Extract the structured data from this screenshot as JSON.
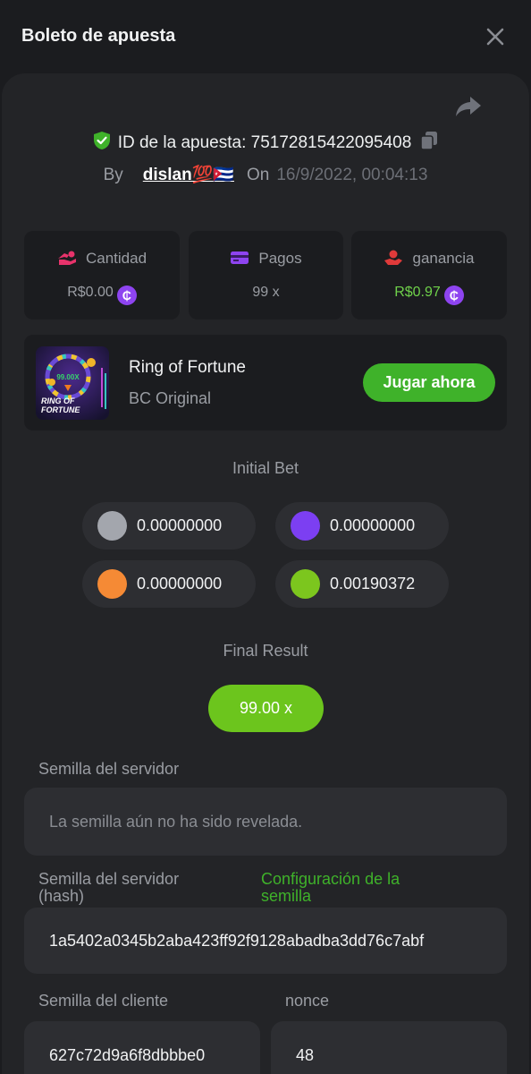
{
  "header": {
    "title": "Boleto de apuesta"
  },
  "bet": {
    "id_label": "ID de la apuesta:",
    "id_value": "75172815422095408",
    "by_label": "By",
    "user": "dislan💯🇨🇺",
    "on_label": "On",
    "date": "16/9/2022, 00:04:13"
  },
  "stats": [
    {
      "title": "Cantidad",
      "value": "R$0.00",
      "icon": "amount-icon",
      "color": "#e8336b"
    },
    {
      "title": "Pagos",
      "value": "99 x",
      "icon": "card-icon",
      "color": "#8e44f0"
    },
    {
      "title": "ganancia",
      "value": "R$0.97",
      "icon": "profit-icon",
      "color": "#e03a3a"
    }
  ],
  "coin_symbol": "₵",
  "game": {
    "name": "Ring of Fortune",
    "provider": "BC Original",
    "play_label": "Jugar ahora",
    "thumb_multiplier": "99.00X",
    "thumb_title_line1": "RING OF",
    "thumb_title_line2": "FORTUNE"
  },
  "initial_bet": {
    "label": "Initial Bet",
    "items": [
      {
        "color": "#a3a6ad",
        "value": "0.00000000"
      },
      {
        "color": "#7c3ff2",
        "value": "0.00000000"
      },
      {
        "color": "#f58a35",
        "value": "0.00000000"
      },
      {
        "color": "#7cc61e",
        "value": "0.00190372"
      }
    ]
  },
  "final_result": {
    "label": "Final Result",
    "value": "99.00 x"
  },
  "server_seed": {
    "label": "Semilla del servidor",
    "placeholder": "La semilla aún no ha sido revelada."
  },
  "server_seed_hash": {
    "label_line1": "Semilla del servidor",
    "label_line2": "(hash)",
    "config_line1": "Configuración de la",
    "config_line2": "semilla",
    "value": "1a5402a0345b2aba423ff92f9128abadba3dd76c7abf"
  },
  "client_seed": {
    "label": "Semilla del cliente",
    "value": "627c72d9a6f8dbbbe0"
  },
  "nonce": {
    "label": "nonce",
    "value": "48"
  }
}
